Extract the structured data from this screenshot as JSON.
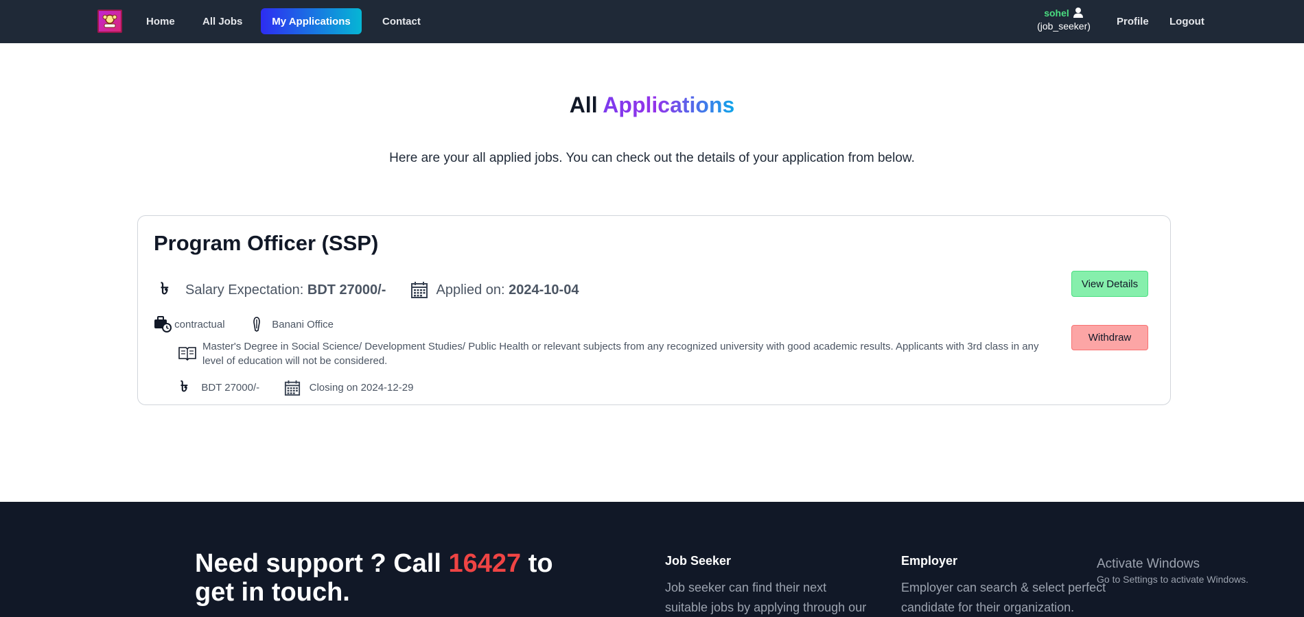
{
  "nav": {
    "links": [
      "Home",
      "All Jobs",
      "My Applications",
      "Contact"
    ],
    "user_name": "sohel",
    "user_role": "(job_seeker)",
    "profile": "Profile",
    "logout": "Logout"
  },
  "hero": {
    "title_plain": "All",
    "title_accent": "Applications",
    "subtitle": "Here are your all applied jobs. You can check out the details of your application from below."
  },
  "application": {
    "job_title": "Program Officer (SSP)",
    "salary_label": "Salary Expectation:",
    "salary_value": "BDT 27000/-",
    "applied_label": "Applied on:",
    "applied_value": "2024-10-04",
    "job_type": "contractual",
    "location": "Banani Office",
    "requirement": "Master's Degree in Social Science/ Development Studies/ Public Health or relevant subjects from any recognized university with good academic results. Applicants with 3rd class in any level of education will not be considered.",
    "job_salary": "BDT 27000/-",
    "closing": "Closing on 2024-12-29",
    "view_button": "View Details",
    "withdraw_button": "Withdraw",
    "taka_symbol": "৳"
  },
  "footer": {
    "support_prefix": "Need support ? Call",
    "support_phone": "16427",
    "support_suffix": "to get in touch.",
    "seeker_heading": "Job Seeker",
    "seeker_text": "Job seeker can find their next suitable jobs by applying through our site.",
    "employer_heading": "Employer",
    "employer_text": "Employer can search & select perfect candidate for their organization."
  },
  "watermark": {
    "line1": "Activate Windows",
    "line2": "Go to Settings to activate Windows."
  },
  "colors": {
    "nav_bg": "#1f2937",
    "footer_bg": "#111827",
    "accent_gradient_start": "#2d2df2",
    "accent_gradient_end": "#06b6d4",
    "view_button": "#86efac",
    "withdraw_button": "#fca5a5",
    "phone": "#ef4444",
    "user_name": "#4ade80"
  }
}
